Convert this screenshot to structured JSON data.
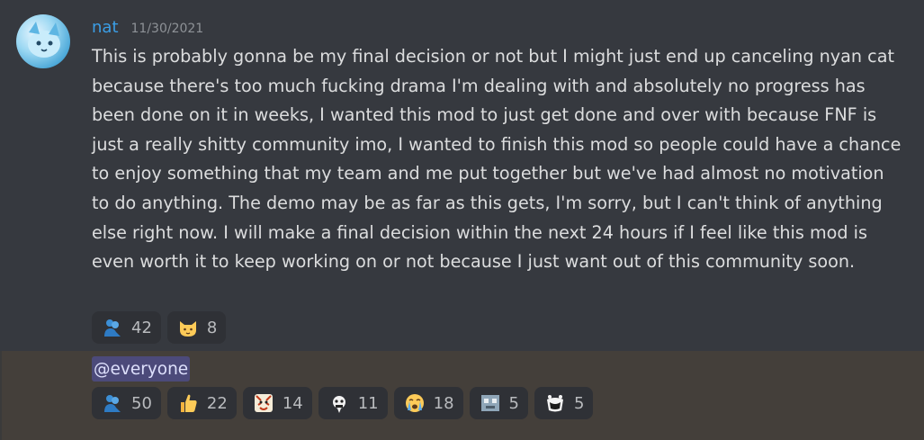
{
  "message": {
    "username": "nat",
    "timestamp": "11/30/2021",
    "text": "This is probably gonna be my final decision or not but I might just end up canceling nyan cat because there's too much fucking drama I'm dealing with and absolutely no progress has been done on it in weeks, I wanted this mod to just get done and over with because FNF is just a really shitty community imo, I wanted to finish this mod so people could have a chance to enjoy something that my team and me put together but we've had almost no motivation to do anything. The demo may be as far as this gets, I'm sorry, but I can't think of anything else right now. I will make a final decision within the next 24 hours if I feel like this mod is even worth it to keep working on or not because I just want out of this community soon.",
    "reactions": [
      {
        "icon": "people-hug-icon",
        "count": "42"
      },
      {
        "icon": "cat-face-icon",
        "count": "8"
      }
    ]
  },
  "followup": {
    "mention": "@everyone",
    "reactions": [
      {
        "icon": "people-hug-icon",
        "count": "50"
      },
      {
        "icon": "thumbs-up-icon",
        "count": "22"
      },
      {
        "icon": "tiger-face-icon",
        "count": "14"
      },
      {
        "icon": "cartoon-face-icon",
        "count": "11"
      },
      {
        "icon": "crying-face-icon",
        "count": "18"
      },
      {
        "icon": "pixel-face-icon",
        "count": "5"
      },
      {
        "icon": "cat-mouth-icon",
        "count": "5"
      }
    ]
  },
  "colors": {
    "username": "#3b9ee6",
    "mention_bg": "#4c4a7a",
    "background": "#36393f",
    "highlight_bg": "#443f3a"
  }
}
